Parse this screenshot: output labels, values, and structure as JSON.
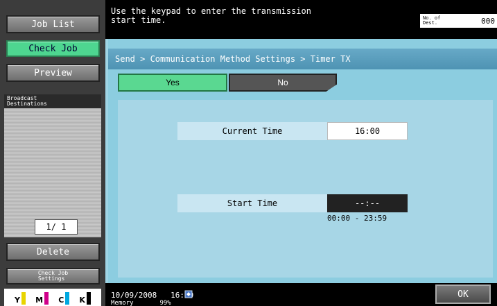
{
  "left_panel": {
    "job_list": "Job List",
    "check_job": "Check Job",
    "preview": "Preview",
    "broadcast_destinations": "Broadcast\nDestinations",
    "page_indicator": "1/ 1",
    "delete": "Delete",
    "check_job_settings": "Check Job\nSettings",
    "toner": [
      {
        "letter": "Y",
        "color": "#e8d400"
      },
      {
        "letter": "M",
        "color": "#d0008a"
      },
      {
        "letter": "C",
        "color": "#00a8e0"
      },
      {
        "letter": "K",
        "color": "#000000"
      }
    ]
  },
  "message": {
    "text": "Use the keypad to enter the transmission\nstart time.",
    "dest_label": "No. of\nDest.",
    "dest_value": "000"
  },
  "main": {
    "breadcrumb": "Send > Communication Method Settings > Timer TX",
    "tabs": [
      {
        "label": "Yes",
        "selected": true
      },
      {
        "label": "No",
        "selected": false
      }
    ],
    "current_time_label": "Current Time",
    "current_time_value": "16:00",
    "start_time_label": "Start Time",
    "start_time_value": "--:--",
    "range": "00:00 - 23:59"
  },
  "footer": {
    "datetime": "10/09/2008   16:00",
    "memory": "Memory       99%",
    "ok": "OK"
  },
  "colors": {
    "accent_green": "#4ed690",
    "panel_blue": "#8ccde0"
  }
}
